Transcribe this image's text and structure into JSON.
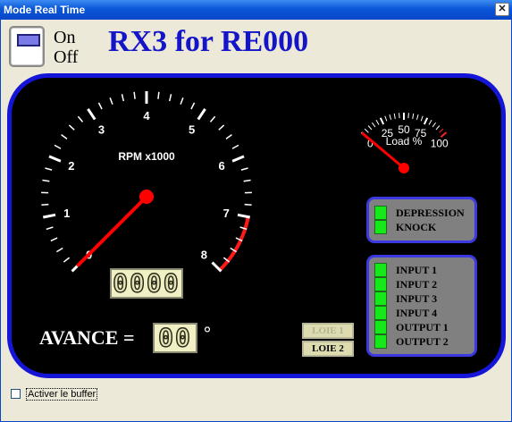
{
  "window": {
    "title": "Mode Real Time",
    "close_glyph": "✕"
  },
  "header": {
    "toggle_on": "On",
    "toggle_off": "Off",
    "app_title": "RX3 for RE000"
  },
  "tachometer": {
    "label": "RPM x1000",
    "ticks": [
      "0",
      "1",
      "2",
      "3",
      "4",
      "5",
      "6",
      "7",
      "8"
    ],
    "value_rpm_x1000": 0,
    "redline_from": 7,
    "needle_color": "#ff0000",
    "lcd_value": "0000"
  },
  "load_gauge": {
    "label": "Load %",
    "ticks": [
      "0",
      "25",
      "50",
      "75",
      "100"
    ],
    "value_percent": 0,
    "needle_color": "#ff0000"
  },
  "advance": {
    "label": "AVANCE =",
    "lcd_value": "00",
    "unit": "°"
  },
  "loie": {
    "loie1": "LOIE 1",
    "loie2": "LOIE 2"
  },
  "indicators_top": [
    {
      "label": "DEPRESSION",
      "color": "#17e817"
    },
    {
      "label": "KNOCK",
      "color": "#17e817"
    }
  ],
  "indicators_io": [
    {
      "label": "INPUT 1",
      "color": "#17e817"
    },
    {
      "label": "INPUT 2",
      "color": "#17e817"
    },
    {
      "label": "INPUT 3",
      "color": "#17e817"
    },
    {
      "label": "INPUT 4",
      "color": "#17e817"
    },
    {
      "label": "OUTPUT 1",
      "color": "#17e817"
    },
    {
      "label": "OUTPUT 2",
      "color": "#17e817"
    }
  ],
  "buffer": {
    "label": "Activer le buffer",
    "checked": false
  }
}
